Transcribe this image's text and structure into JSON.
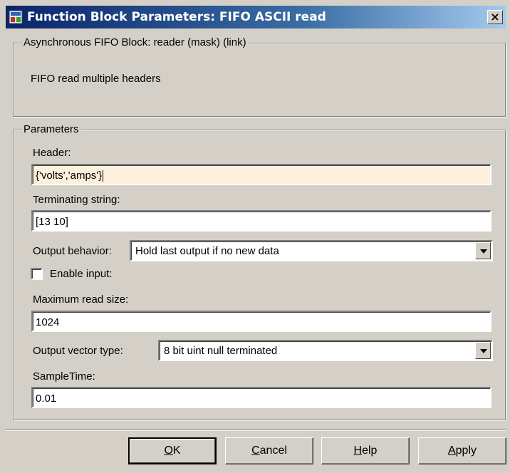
{
  "window": {
    "title": "Function Block Parameters: FIFO ASCII read",
    "close_glyph": "×"
  },
  "description": {
    "group_title": "Asynchronous FIFO Block: reader (mask) (link)",
    "text": "FIFO read multiple headers"
  },
  "parameters": {
    "group_title": "Parameters",
    "header": {
      "label": "Header:",
      "value": "{'volts','amps'}"
    },
    "terminating_string": {
      "label": "Terminating string:",
      "value": "[13 10]"
    },
    "output_behavior": {
      "label": "Output behavior:",
      "value": "Hold last output if no new data"
    },
    "enable_input": {
      "label": "Enable input:",
      "checked": false
    },
    "maximum_read_size": {
      "label": "Maximum read size:",
      "value": "1024"
    },
    "output_vector_type": {
      "label": "Output vector type:",
      "value": "8 bit uint null terminated"
    },
    "sample_time": {
      "label": "SampleTime:",
      "value": "0.01"
    }
  },
  "buttons": {
    "ok": {
      "mnemonic": "O",
      "rest": "K"
    },
    "cancel": {
      "mnemonic": "C",
      "rest": "ancel"
    },
    "help": {
      "mnemonic": "H",
      "rest": "elp"
    },
    "apply": {
      "mnemonic": "A",
      "rest": "pply"
    }
  },
  "colors": {
    "dialog_bg": "#d4d0c8",
    "titlebar_start": "#0a246a",
    "titlebar_end": "#a6caf0",
    "active_field_bg": "#fdf0dc"
  },
  "icons": {
    "app_icon": "simulink-block-icon",
    "close": "close-icon",
    "dropdown": "chevron-down-icon"
  }
}
